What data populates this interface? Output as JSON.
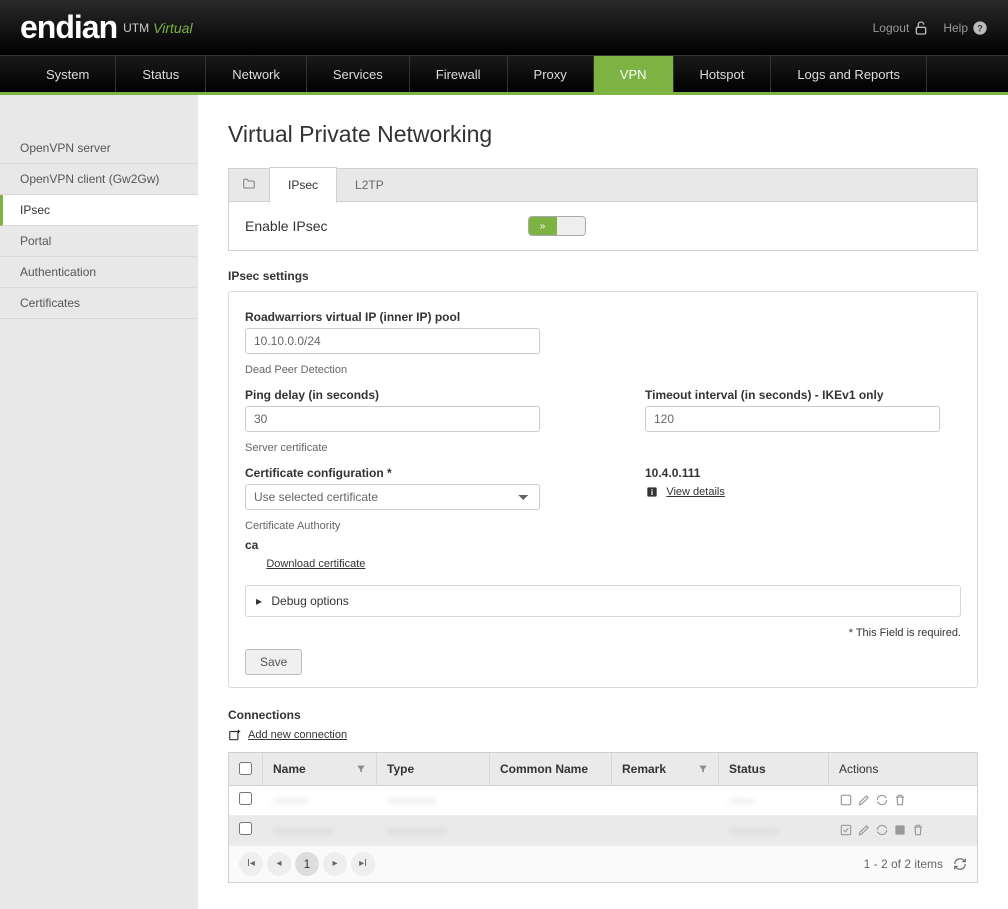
{
  "brand": {
    "name": "endian",
    "utm": "UTM",
    "virtual": "Virtual"
  },
  "header": {
    "logout": "Logout",
    "help": "Help"
  },
  "topnav": [
    "System",
    "Status",
    "Network",
    "Services",
    "Firewall",
    "Proxy",
    "VPN",
    "Hotspot",
    "Logs and Reports"
  ],
  "topnav_active": 6,
  "sidebar": [
    "OpenVPN server",
    "OpenVPN client (Gw2Gw)",
    "IPsec",
    "Portal",
    "Authentication",
    "Certificates"
  ],
  "sidebar_active": 2,
  "page_title": "Virtual Private Networking",
  "tabs": [
    "IPsec",
    "L2TP"
  ],
  "tabs_active": 0,
  "enable": {
    "label": "Enable IPsec"
  },
  "section_settings": "IPsec settings",
  "fields": {
    "roadwarriors_label": "Roadwarriors virtual IP (inner IP) pool",
    "roadwarriors_value": "10.10.0.0/24",
    "dpd": "Dead Peer Detection",
    "ping_delay_label": "Ping delay (in seconds)",
    "ping_delay_value": "30",
    "timeout_label": "Timeout interval (in seconds) - IKEv1 only",
    "timeout_value": "120",
    "server_cert": "Server certificate",
    "cert_config_label": "Certificate configuration *",
    "cert_config_value": "Use selected certificate",
    "cert_ip": "10.4.0.111",
    "view_details": "View details",
    "ca_section": "Certificate Authority",
    "ca_label": "ca",
    "download_cert": "Download certificate",
    "debug": "Debug options",
    "required_note": "* This Field is required.",
    "save": "Save"
  },
  "connections": {
    "title": "Connections",
    "add_link": "Add new connection",
    "columns": [
      "Name",
      "Type",
      "Common Name",
      "Remark",
      "Status",
      "Actions"
    ],
    "rows": [
      {
        "name": "———",
        "type": "————",
        "common": "",
        "remark": "",
        "status": "——"
      },
      {
        "name": "—————",
        "type": "—————",
        "common": "",
        "remark": "",
        "status": "————"
      }
    ],
    "footer_text": "1 - 2 of 2 items",
    "page": "1"
  }
}
